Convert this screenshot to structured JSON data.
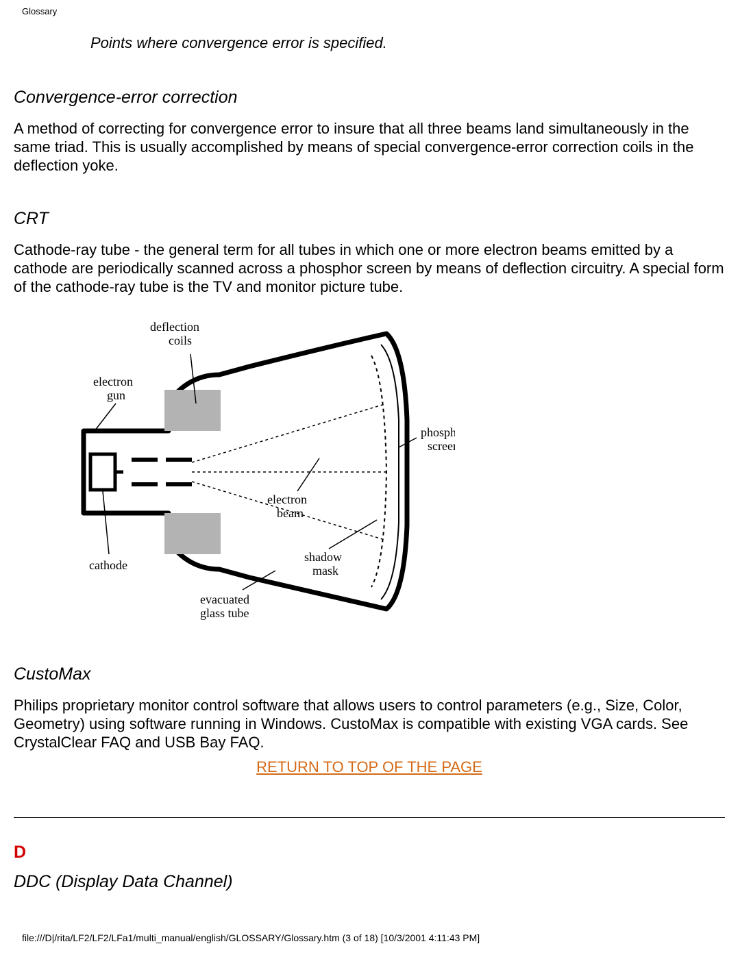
{
  "header": {
    "title": "Glossary"
  },
  "intro_caption": "Points where convergence error is specified.",
  "sections": {
    "conv_err": {
      "heading": "Convergence-error correction",
      "body": "A method of correcting for convergence error to insure that all three beams land simultaneously in the same triad. This is usually accomplished by means of special convergence-error correction coils in the deflection yoke."
    },
    "crt": {
      "heading": "CRT",
      "body": "Cathode-ray tube - the general term for all tubes in which one or more electron beams emitted by a cathode are periodically scanned across a phosphor screen by means of deflection circuitry. A special form of the cathode-ray tube is the TV and monitor picture tube.",
      "diagram_labels": {
        "deflection_coils": "deflection\ncoils",
        "electron_gun": "electron\ngun",
        "phosphor_screen": "phosphor\nscreen",
        "electron_beam": "electron\nbeam",
        "cathode": "cathode",
        "shadow_mask": "shadow\nmask",
        "evacuated": "evacuated\nglass tube"
      }
    },
    "customax": {
      "heading": "CustoMax",
      "body": "Philips proprietary monitor control software that allows users to control parameters (e.g., Size, Color, Geometry) using software running in Windows. CustoMax is compatible with existing VGA cards. See CrystalClear FAQ and USB Bay FAQ."
    },
    "top_link": "RETURN TO TOP OF THE PAGE",
    "letter_d": "D",
    "ddc": {
      "heading": "DDC (Display Data Channel)"
    }
  },
  "footer": "file:///D|/rita/LF2/LF2/LFa1/multi_manual/english/GLOSSARY/Glossary.htm (3 of 18) [10/3/2001 4:11:43 PM]"
}
